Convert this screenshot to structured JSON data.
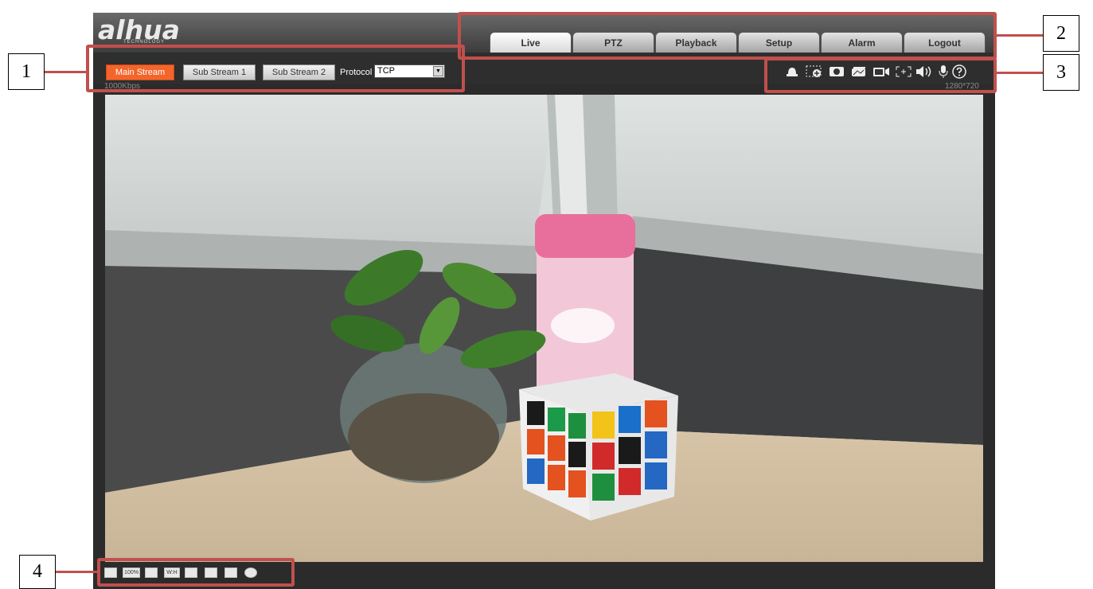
{
  "brand": {
    "logo_text": "alhua",
    "tagline": "TECHNOLOGY"
  },
  "nav_tabs": [
    {
      "label": "Live",
      "active": true
    },
    {
      "label": "PTZ",
      "active": false
    },
    {
      "label": "Playback",
      "active": false
    },
    {
      "label": "Setup",
      "active": false
    },
    {
      "label": "Alarm",
      "active": false
    },
    {
      "label": "Logout",
      "active": false
    }
  ],
  "stream_bar": {
    "main_stream": "Main Stream",
    "sub_stream_1": "Sub Stream 1",
    "sub_stream_2": "Sub Stream 2",
    "protocol_label": "Protocol",
    "protocol_value": "TCP",
    "bitrate_left": "1000Kbps",
    "resolution_right": "1280*720"
  },
  "live_tools": [
    "alarm-output-icon",
    "digital-zoom-icon",
    "snapshot-icon",
    "triple-snapshot-icon",
    "record-icon",
    "easy-focus-icon",
    "audio-output-icon",
    "microphone-icon",
    "help-icon"
  ],
  "bottom_tools": [
    {
      "icon": "image-adjust-icon",
      "label": ""
    },
    {
      "icon": "original-size-icon",
      "label": "100%"
    },
    {
      "icon": "fullscreen-icon",
      "label": ""
    },
    {
      "icon": "width-height-ratio-icon",
      "label": "W:H"
    },
    {
      "icon": "fluency-icon",
      "label": ""
    },
    {
      "icon": "rule-info-icon",
      "label": ""
    },
    {
      "icon": "zoom-focus-icon",
      "label": ""
    },
    {
      "icon": "face-icon",
      "label": ""
    }
  ],
  "callouts": [
    "1",
    "2",
    "3",
    "4"
  ],
  "colors": {
    "accent": "#f3652a",
    "annotation": "#c0504d",
    "panel": "#2b2b2b"
  }
}
